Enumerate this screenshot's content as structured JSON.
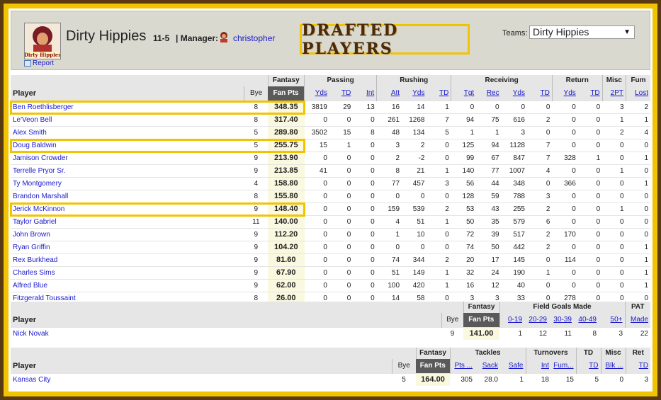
{
  "header": {
    "team_name": "Dirty Hippies",
    "record": "11-5",
    "manager_label": "| Manager:",
    "manager_name": "christopher",
    "report_label": "Report",
    "logo_text": "Dirty Hippies",
    "banner": "DRAFTED PLAYERS",
    "teams_label": "Teams:",
    "teams_selected": "Dirty Hippies"
  },
  "offense": {
    "group_headers": [
      "Fantasy",
      "Passing",
      "Rushing",
      "Receiving",
      "Return",
      "Misc",
      "Fum"
    ],
    "player_label": "Player",
    "bye_label": "Bye",
    "fanpts_label": "Fan Pts",
    "columns": [
      "Yds",
      "TD",
      "Int",
      "Att",
      "Yds",
      "TD",
      "Tgt",
      "Rec",
      "Yds",
      "TD",
      "Yds",
      "TD",
      "2PT",
      "Lost"
    ],
    "rows": [
      {
        "name": "Ben Roethlisberger",
        "bye": "8",
        "pts": "348.35",
        "stats": [
          "3819",
          "29",
          "13",
          "16",
          "14",
          "1",
          "0",
          "0",
          "0",
          "0",
          "0",
          "0",
          "3",
          "2"
        ],
        "drafted": true
      },
      {
        "name": "Le'Veon Bell",
        "bye": "8",
        "pts": "317.40",
        "stats": [
          "0",
          "0",
          "0",
          "261",
          "1268",
          "7",
          "94",
          "75",
          "616",
          "2",
          "0",
          "0",
          "1",
          "1"
        ],
        "drafted": false
      },
      {
        "name": "Alex Smith",
        "bye": "5",
        "pts": "289.80",
        "stats": [
          "3502",
          "15",
          "8",
          "48",
          "134",
          "5",
          "1",
          "1",
          "3",
          "0",
          "0",
          "0",
          "2",
          "4"
        ],
        "drafted": false
      },
      {
        "name": "Doug Baldwin",
        "bye": "5",
        "pts": "255.75",
        "stats": [
          "15",
          "1",
          "0",
          "3",
          "2",
          "0",
          "125",
          "94",
          "1128",
          "7",
          "0",
          "0",
          "0",
          "0"
        ],
        "drafted": true
      },
      {
        "name": "Jamison Crowder",
        "bye": "9",
        "pts": "213.90",
        "stats": [
          "0",
          "0",
          "0",
          "2",
          "-2",
          "0",
          "99",
          "67",
          "847",
          "7",
          "328",
          "1",
          "0",
          "1"
        ],
        "drafted": false
      },
      {
        "name": "Terrelle Pryor Sr.",
        "bye": "9",
        "pts": "213.85",
        "stats": [
          "41",
          "0",
          "0",
          "8",
          "21",
          "1",
          "140",
          "77",
          "1007",
          "4",
          "0",
          "0",
          "1",
          "0"
        ],
        "drafted": false
      },
      {
        "name": "Ty Montgomery",
        "bye": "4",
        "pts": "158.80",
        "stats": [
          "0",
          "0",
          "0",
          "77",
          "457",
          "3",
          "56",
          "44",
          "348",
          "0",
          "366",
          "0",
          "0",
          "1"
        ],
        "drafted": false
      },
      {
        "name": "Brandon Marshall",
        "bye": "8",
        "pts": "155.80",
        "stats": [
          "0",
          "0",
          "0",
          "0",
          "0",
          "0",
          "128",
          "59",
          "788",
          "3",
          "0",
          "0",
          "0",
          "0"
        ],
        "drafted": false
      },
      {
        "name": "Jerick McKinnon",
        "bye": "9",
        "pts": "148.40",
        "stats": [
          "0",
          "0",
          "0",
          "159",
          "539",
          "2",
          "53",
          "43",
          "255",
          "2",
          "0",
          "0",
          "1",
          "0"
        ],
        "drafted": true
      },
      {
        "name": "Taylor Gabriel",
        "bye": "11",
        "pts": "140.00",
        "stats": [
          "0",
          "0",
          "0",
          "4",
          "51",
          "1",
          "50",
          "35",
          "579",
          "6",
          "0",
          "0",
          "0",
          "0"
        ],
        "drafted": false
      },
      {
        "name": "John Brown",
        "bye": "9",
        "pts": "112.20",
        "stats": [
          "0",
          "0",
          "0",
          "1",
          "10",
          "0",
          "72",
          "39",
          "517",
          "2",
          "170",
          "0",
          "0",
          "0"
        ],
        "drafted": false
      },
      {
        "name": "Ryan Griffin",
        "bye": "9",
        "pts": "104.20",
        "stats": [
          "0",
          "0",
          "0",
          "0",
          "0",
          "0",
          "74",
          "50",
          "442",
          "2",
          "0",
          "0",
          "0",
          "1"
        ],
        "drafted": false
      },
      {
        "name": "Rex Burkhead",
        "bye": "9",
        "pts": "81.60",
        "stats": [
          "0",
          "0",
          "0",
          "74",
          "344",
          "2",
          "20",
          "17",
          "145",
          "0",
          "114",
          "0",
          "0",
          "1"
        ],
        "drafted": false
      },
      {
        "name": "Charles Sims",
        "bye": "9",
        "pts": "67.90",
        "stats": [
          "0",
          "0",
          "0",
          "51",
          "149",
          "1",
          "32",
          "24",
          "190",
          "1",
          "0",
          "0",
          "0",
          "1"
        ],
        "drafted": false
      },
      {
        "name": "Alfred Blue",
        "bye": "9",
        "pts": "62.00",
        "stats": [
          "0",
          "0",
          "0",
          "100",
          "420",
          "1",
          "16",
          "12",
          "40",
          "0",
          "0",
          "0",
          "0",
          "1"
        ],
        "drafted": false
      },
      {
        "name": "Fitzgerald Toussaint",
        "bye": "8",
        "pts": "26.00",
        "stats": [
          "0",
          "0",
          "0",
          "14",
          "58",
          "0",
          "3",
          "3",
          "33",
          "0",
          "278",
          "0",
          "0",
          "0"
        ],
        "drafted": false
      }
    ]
  },
  "kicker": {
    "group_headers": [
      "Fantasy",
      "Field Goals Made",
      "PAT"
    ],
    "player_label": "Player",
    "bye_label": "Bye",
    "fanpts_label": "Fan Pts",
    "columns": [
      "0-19",
      "20-29",
      "30-39",
      "40-49",
      "50+",
      "Made"
    ],
    "rows": [
      {
        "name": "Nick Novak",
        "bye": "9",
        "pts": "141.00",
        "stats": [
          "1",
          "12",
          "11",
          "8",
          "3",
          "22"
        ]
      }
    ]
  },
  "defense": {
    "group_headers": [
      "Fantasy",
      "Tackles",
      "Turnovers",
      "TD",
      "Misc",
      "Ret"
    ],
    "player_label": "Player",
    "bye_label": "Bye",
    "fanpts_label": "Fan Pts",
    "columns": [
      "Pts ...",
      "Sack",
      "Safe",
      "Int",
      "Fum...",
      "TD",
      "Blk ...",
      "TD"
    ],
    "rows": [
      {
        "name": "Kansas City",
        "bye": "5",
        "pts": "164.00",
        "stats": [
          "305",
          "28.0",
          "1",
          "18",
          "15",
          "5",
          "0",
          "3"
        ]
      }
    ]
  },
  "colors": {
    "frame_outer": "#5a3a10",
    "frame_yellow": "#f0c400",
    "link": "#1a1acc",
    "header_bg": "#d9d9d0",
    "fanpts_bg": "#5a5a5a"
  }
}
